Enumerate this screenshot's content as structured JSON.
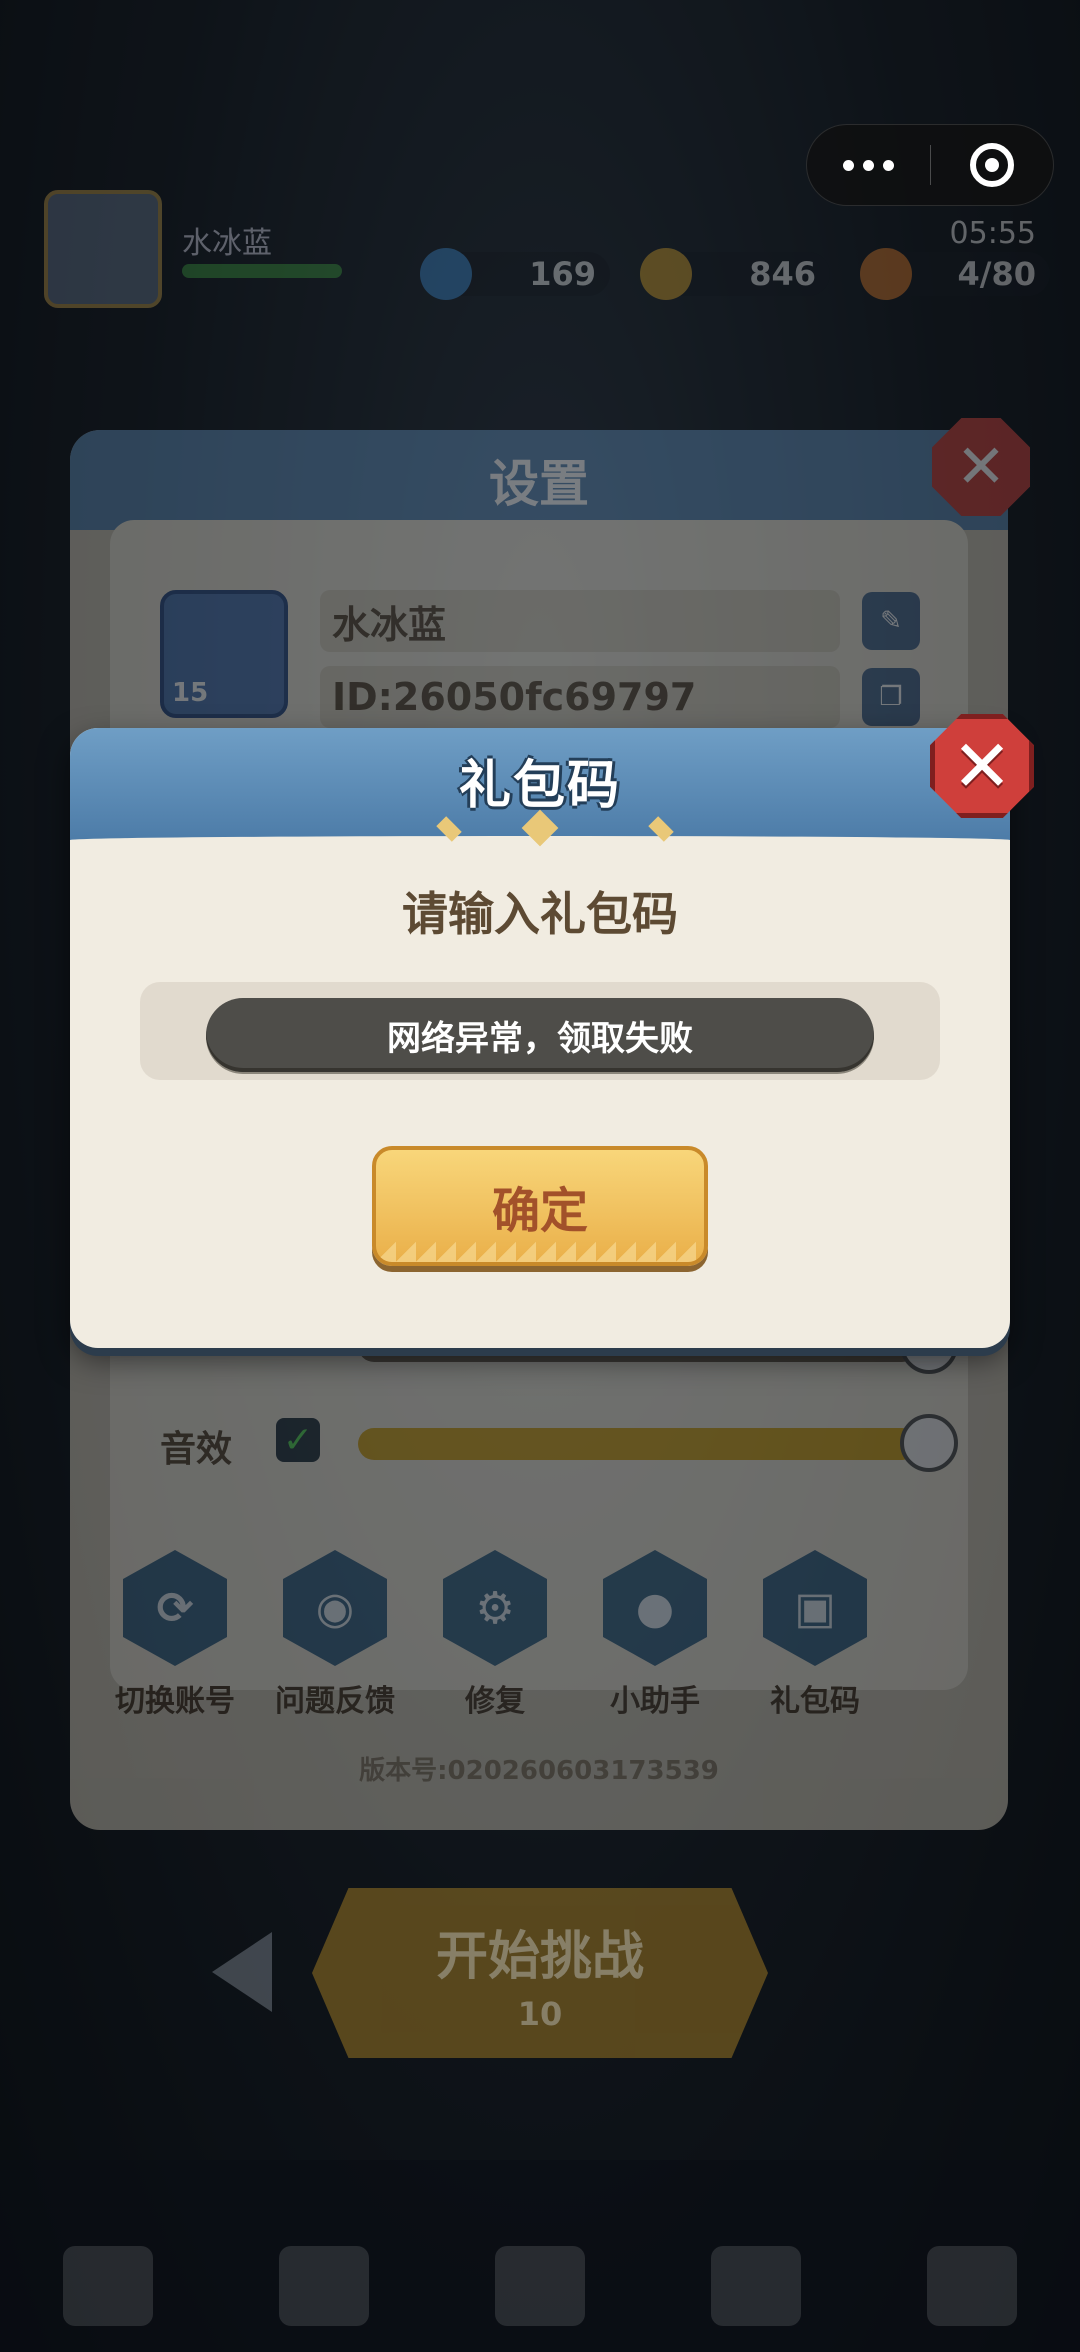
{
  "hud": {
    "player_name": "水冰蓝",
    "player_level": "15",
    "gems": "169",
    "coins": "846",
    "stamina": "4/80",
    "timer": "05:55"
  },
  "settings": {
    "title": "设置",
    "profile": {
      "name": "水冰蓝",
      "id": "ID:26050fc69797",
      "level": "15"
    },
    "sound_effect_label": "音效",
    "sound_effect_enabled": true,
    "buttons": [
      {
        "label": "切换账号",
        "icon": "switch-account-icon"
      },
      {
        "label": "问题反馈",
        "icon": "feedback-icon"
      },
      {
        "label": "修复",
        "icon": "repair-gear-icon"
      },
      {
        "label": "小助手",
        "icon": "wechat-assistant-icon"
      },
      {
        "label": "礼包码",
        "icon": "gift-box-icon"
      }
    ],
    "version": "版本号:020260603173539"
  },
  "dialog": {
    "title": "礼包码",
    "prompt": "请输入礼包码",
    "toast": "网络异常，领取失败",
    "confirm_label": "确定"
  },
  "main": {
    "start_label": "开始挑战",
    "start_cost": "10"
  },
  "colors": {
    "dialog_header": "#5d89b3",
    "close_red": "#cf3f3b",
    "confirm_gold": "#f2c25e",
    "dialog_body": "#f1ece1"
  }
}
